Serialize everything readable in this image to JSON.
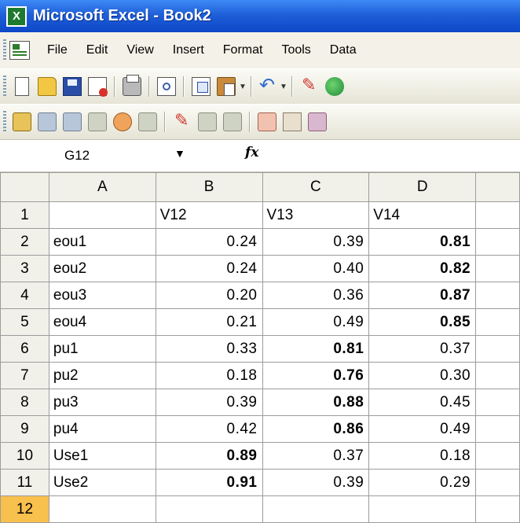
{
  "window": {
    "title": "Microsoft Excel - Book2",
    "app_icon_glyph": "X"
  },
  "menu": {
    "items": [
      {
        "label": "File"
      },
      {
        "label": "Edit"
      },
      {
        "label": "View"
      },
      {
        "label": "Insert"
      },
      {
        "label": "Format"
      },
      {
        "label": "Tools"
      },
      {
        "label": "Data"
      }
    ]
  },
  "toolbar1": {
    "icons": [
      "new-document-icon",
      "open-folder-icon",
      "save-icon",
      "permission-icon",
      "print-icon",
      "print-preview-icon",
      "copy-icon",
      "paste-icon",
      "undo-icon",
      "ink-icon",
      "research-globe-icon"
    ]
  },
  "toolbar2": {
    "icons": [
      "toolbar2-icon-1",
      "toolbar2-icon-2",
      "toolbar2-icon-3",
      "toolbar2-icon-4",
      "toolbar2-icon-5",
      "toolbar2-icon-6",
      "toolbar2-icon-7",
      "toolbar2-icon-8",
      "toolbar2-icon-9",
      "toolbar2-icon-10",
      "toolbar2-icon-11",
      "toolbar2-icon-12"
    ]
  },
  "formula_bar": {
    "name_box": "G12",
    "fx_label": "fx",
    "formula": ""
  },
  "sheet": {
    "columns": [
      "A",
      "B",
      "C",
      "D"
    ],
    "active_row": "12",
    "rows": [
      {
        "n": "1",
        "a": "",
        "b": "V12",
        "c": "V13",
        "d": "V14"
      },
      {
        "n": "2",
        "a": "eou1",
        "b": "0.24",
        "c": "0.39",
        "d": "0.81"
      },
      {
        "n": "3",
        "a": "eou2",
        "b": "0.24",
        "c": "0.40",
        "d": "0.82"
      },
      {
        "n": "4",
        "a": "eou3",
        "b": "0.20",
        "c": "0.36",
        "d": "0.87"
      },
      {
        "n": "5",
        "a": "eou4",
        "b": "0.21",
        "c": "0.49",
        "d": "0.85"
      },
      {
        "n": "6",
        "a": "pu1",
        "b": "0.33",
        "c": "0.81",
        "d": "0.37"
      },
      {
        "n": "7",
        "a": "pu2",
        "b": "0.18",
        "c": "0.76",
        "d": "0.30"
      },
      {
        "n": "8",
        "a": "pu3",
        "b": "0.39",
        "c": "0.88",
        "d": "0.45"
      },
      {
        "n": "9",
        "a": "pu4",
        "b": "0.42",
        "c": "0.86",
        "d": "0.49"
      },
      {
        "n": "10",
        "a": "Use1",
        "b": "0.89",
        "c": "0.37",
        "d": "0.18"
      },
      {
        "n": "11",
        "a": "Use2",
        "b": "0.91",
        "c": "0.39",
        "d": "0.29"
      },
      {
        "n": "12",
        "a": "",
        "b": "",
        "c": "",
        "d": ""
      }
    ],
    "bold_cells": [
      "D2",
      "D3",
      "D4",
      "D5",
      "C6",
      "C7",
      "C8",
      "C9",
      "B10",
      "B11"
    ]
  },
  "colors": {
    "titlebar": "#0d47c8",
    "active_row_header": "#f8c04c",
    "grid_border": "#9c9c9c"
  }
}
